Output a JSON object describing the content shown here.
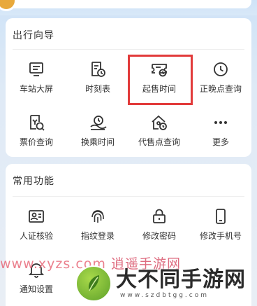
{
  "sections": {
    "guide": {
      "title": "出行向导",
      "items": [
        {
          "label": "车站大屏",
          "icon": "station-screen-icon"
        },
        {
          "label": "时刻表",
          "icon": "timetable-icon"
        },
        {
          "label": "起售时间",
          "icon": "sale-time-icon",
          "highlighted": true
        },
        {
          "label": "正晚点查询",
          "icon": "clock-icon"
        },
        {
          "label": "票价查询",
          "icon": "ticket-price-icon"
        },
        {
          "label": "换乘时间",
          "icon": "transfer-time-icon"
        },
        {
          "label": "代售点查询",
          "icon": "agency-icon"
        },
        {
          "label": "更多",
          "icon": "more-icon"
        }
      ]
    },
    "common": {
      "title": "常用功能",
      "items": [
        {
          "label": "人证核验",
          "icon": "id-card-icon"
        },
        {
          "label": "指纹登录",
          "icon": "fingerprint-icon"
        },
        {
          "label": "修改密码",
          "icon": "lock-icon"
        },
        {
          "label": "修改手机号",
          "icon": "phone-icon"
        },
        {
          "label": "通知设置",
          "icon": "bell-icon"
        }
      ]
    }
  },
  "watermark": {
    "site_text": "www.xyzs.com",
    "site_name": "逍遥手游网",
    "brand_name": "大不同手游网",
    "brand_url": "www.szdbtgg.com"
  },
  "colors": {
    "highlight_border": "#e23b3b",
    "icon_stroke": "#333333"
  }
}
